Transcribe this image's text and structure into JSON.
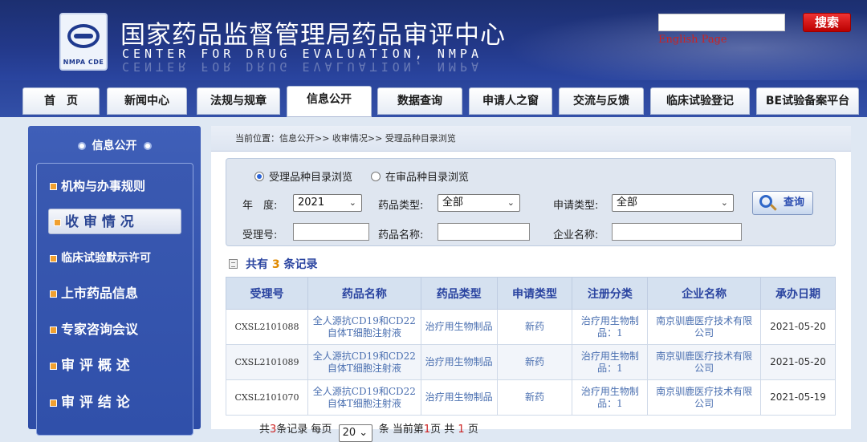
{
  "header": {
    "logo_text": "NMPA CDE",
    "title": "国家药品监督管理局药品审评中心",
    "subtitle": "CENTER FOR DRUG EVALUATION, NMPA",
    "search_value": "",
    "search_button": "搜索",
    "english_link": "English Page"
  },
  "nav": {
    "tabs": [
      {
        "label": "首　页"
      },
      {
        "label": "新闻中心"
      },
      {
        "label": "法规与规章"
      },
      {
        "label": "信息公开"
      },
      {
        "label": "数据查询"
      },
      {
        "label": "申请人之窗"
      },
      {
        "label": "交流与反馈"
      },
      {
        "label": "临床试验登记"
      },
      {
        "label": "BE试验备案平台"
      }
    ],
    "active": "信息公开"
  },
  "sidebar": {
    "title": "信息公开",
    "items": [
      {
        "label": "机构与办事规则"
      },
      {
        "label": "收 审 情 况"
      },
      {
        "label": "临床试验默示许可"
      },
      {
        "label": "上市药品信息"
      },
      {
        "label": "专家咨询会议"
      },
      {
        "label": "审 评 概 述"
      },
      {
        "label": "审 评 结 论"
      }
    ]
  },
  "breadcrumb": "当前位置：信息公开>> 收审情况>> 受理品种目录浏览",
  "query": {
    "radio_options": [
      "受理品种目录浏览",
      "在审品种目录浏览"
    ],
    "selected_radio": "受理品种目录浏览",
    "year_label": "年　度:",
    "year_value": "2021",
    "drug_type_label": "药品类型:",
    "drug_type_value": "全部",
    "apply_type_label": "申请类型:",
    "apply_type_value": "全部",
    "accept_no_label": "受理号:",
    "accept_no_value": "",
    "drug_name_label": "药品名称:",
    "drug_name_value": "",
    "company_label": "企业名称:",
    "company_value": "",
    "query_button": "查询"
  },
  "records": {
    "prefix": "共有",
    "count": "3",
    "suffix": "条记录"
  },
  "table": {
    "headers": [
      "受理号",
      "药品名称",
      "药品类型",
      "申请类型",
      "注册分类",
      "企业名称",
      "承办日期"
    ],
    "rows": [
      [
        "CXSL2101088",
        "全人源抗CD19和CD22自体T细胞注射液",
        "治疗用生物制品",
        "新药",
        "治疗用生物制品：1",
        "南京驯鹿医疗技术有限公司",
        "2021-05-20"
      ],
      [
        "CXSL2101089",
        "全人源抗CD19和CD22自体T细胞注射液",
        "治疗用生物制品",
        "新药",
        "治疗用生物制品：1",
        "南京驯鹿医疗技术有限公司",
        "2021-05-20"
      ],
      [
        "CXSL2101070",
        "全人源抗CD19和CD22自体T细胞注射液",
        "治疗用生物制品",
        "新药",
        "治疗用生物制品：1",
        "南京驯鹿医疗技术有限公司",
        "2021-05-19"
      ]
    ]
  },
  "pager": {
    "t1": "共",
    "total": "3",
    "t2": "条记录 每页",
    "page_size": "20",
    "t3": "条 当前第",
    "current": "1",
    "t4": "页 共",
    "pages": "1",
    "t5": "页"
  },
  "colors": {
    "header_blue": "#23398a",
    "accent_red": "#cc2222",
    "table_text": "#4a6fb0"
  }
}
